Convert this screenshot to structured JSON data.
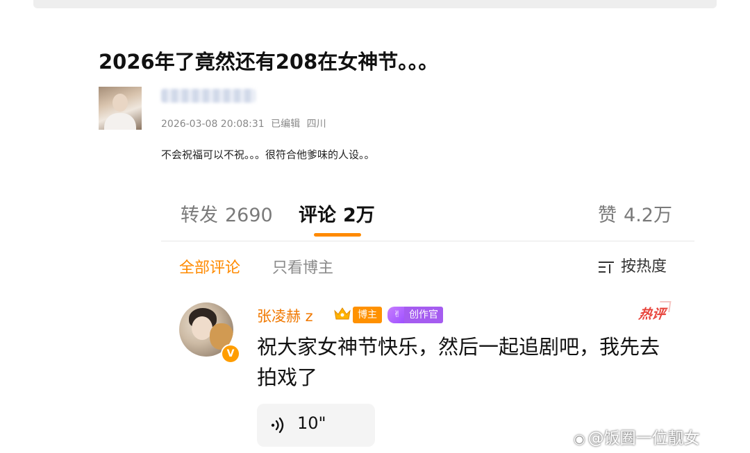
{
  "post": {
    "title": "2026年了竟然还有208在女神节。。。",
    "date": "2026-03-08 20:08:31",
    "edited": "已编辑",
    "location": "四川",
    "body": "不会祝福可以不祝。。。很符合他爹味的人设。。"
  },
  "stats": {
    "repost_label": "转发",
    "repost_count": "2690",
    "comment_label": "评论",
    "comment_count": "2万",
    "like_label": "赞",
    "like_count": "4.2万"
  },
  "filters": {
    "all": "全部评论",
    "blogger_only": "只看博主",
    "sort": "按热度"
  },
  "comment": {
    "author": "张凌赫 z",
    "blogger_tag": "博主",
    "creator_tag": "创作官",
    "hot_badge": "热评",
    "text": "祝大家女神节快乐，然后一起追剧吧，我先去拍戏了",
    "voice_duration": "10\""
  },
  "watermark": {
    "text": "@饭圈一位靓女"
  },
  "colors": {
    "accent_orange": "#ff8a00",
    "hot_red": "#e8453c",
    "creator_purple": "#a55cf0"
  },
  "icons": {
    "sort": "sort-lines-icon",
    "voice": "sound-wave-icon",
    "crown": "crown-icon",
    "verified": "verified-v-icon"
  }
}
